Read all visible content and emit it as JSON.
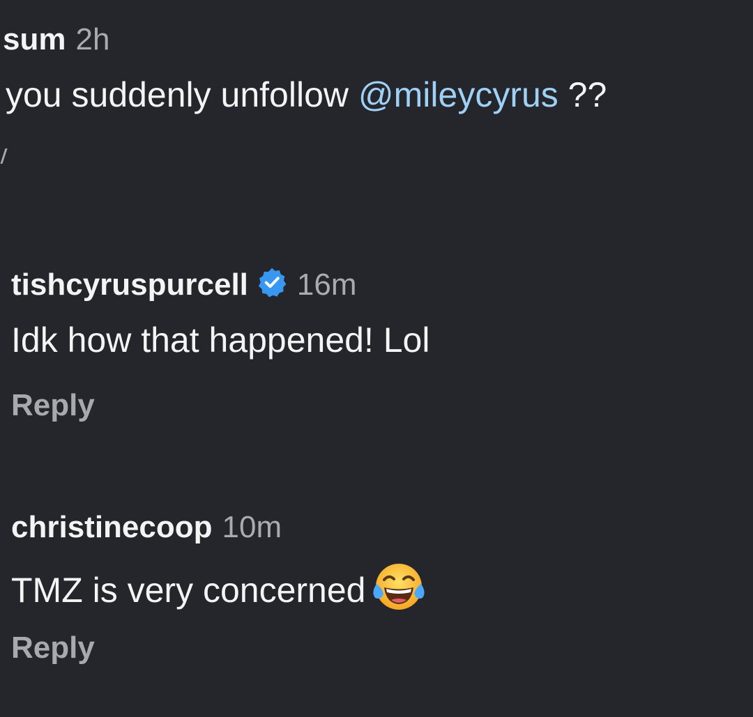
{
  "comments": [
    {
      "username": "sum",
      "time": "2h",
      "text_before": "you suddenly unfollow ",
      "mention": "@mileycyrus",
      "text_after": " ??"
    },
    {
      "username": "tishcyruspurcell",
      "verified": true,
      "time": "16m",
      "text": "Idk how that happened! Lol",
      "reply_label": "Reply"
    },
    {
      "username": "christinecoop",
      "time": "10m",
      "text": "TMZ is very concerned",
      "emoji": "face-with-tears-of-joy-icon",
      "reply_label": "Reply"
    }
  ],
  "colors": {
    "background": "#25262b",
    "text": "#f4f4f4",
    "muted": "#a9abb0",
    "mention": "#9fd0f5",
    "verified_badge": "#3897f0"
  }
}
